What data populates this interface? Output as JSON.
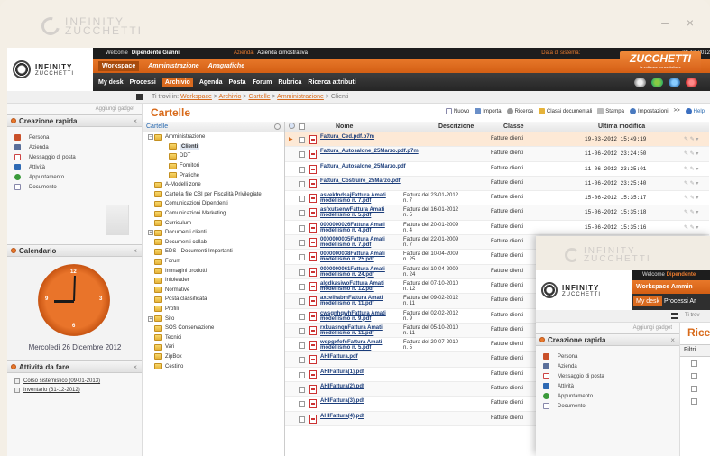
{
  "outer": {
    "logo_line1": "INFINITY",
    "logo_line2": "ZUCCHETTI",
    "controls": "– ×"
  },
  "header": {
    "logo_line1": "INFINITY",
    "logo_line2": "ZUCCHETTI",
    "welcome_label": "Welcome",
    "user": "Dipendente Gianni",
    "company_label": "Azienda:",
    "company": "Azienda dimostrativa",
    "date_label": "Data di sistema:",
    "date": "26-12-2012",
    "brand": "ZUCCHETTI",
    "brand_tagline": "la software house italiana",
    "modules": [
      "Workspace",
      "Amministrazione",
      "Anagrafiche"
    ],
    "menu": [
      "My desk",
      "Processi",
      "Archivio",
      "Agenda",
      "Posta",
      "Forum",
      "Rubrica",
      "Ricerca attributi"
    ]
  },
  "breadcrumb": {
    "prefix": "Ti trovi in:",
    "items": [
      "Workspace",
      "Archivio",
      "Cartelle",
      "Amministrazione"
    ],
    "current": "Clienti",
    "sep": ">"
  },
  "left": {
    "add_gadget": "Aggiungi gadget",
    "quick_title": "Creazione rapida",
    "quick_items": [
      "Persona",
      "Azienda",
      "Messaggio di posta",
      "Attività",
      "Appuntamento",
      "Documento"
    ],
    "calendar_title": "Calendario",
    "calendar_date": "Mercoledì 26 Dicembre 2012",
    "todo_title": "Attività da fare",
    "todo_items": [
      "Corso sistemistico (09-01-2013)",
      "Inventario (31-12-2012)"
    ],
    "close": "×"
  },
  "main": {
    "title": "Cartelle",
    "toolbar": [
      "Nuovo",
      "Importa",
      "Ricerca",
      "Classi documentali",
      "Stampa",
      "Impostazioni",
      ">>",
      "Help"
    ],
    "tree_root": "Cartelle",
    "tree": [
      {
        "label": "Amministrazione",
        "depth": 0,
        "pm": "−"
      },
      {
        "label": "Clienti",
        "depth": 2,
        "sel": true
      },
      {
        "label": "DDT",
        "depth": 2
      },
      {
        "label": "Fornitori",
        "depth": 2
      },
      {
        "label": "Pratiche",
        "depth": 2
      },
      {
        "label": "A-Modelli zone",
        "depth": 0
      },
      {
        "label": "Cartella file CBI per Fiscalità Privilegiate",
        "depth": 0
      },
      {
        "label": "Comunicazioni Dipendenti",
        "depth": 0
      },
      {
        "label": "Comunicazioni Marketing",
        "depth": 0
      },
      {
        "label": "Curriculum",
        "depth": 0
      },
      {
        "label": "Documenti clienti",
        "depth": 0,
        "pm": "+"
      },
      {
        "label": "Documenti collab",
        "depth": 0
      },
      {
        "label": "EDS - Documenti Importanti",
        "depth": 0
      },
      {
        "label": "Forum",
        "depth": 0
      },
      {
        "label": "Immagini prodotti",
        "depth": 0
      },
      {
        "label": "Infoleader",
        "depth": 0
      },
      {
        "label": "Normative",
        "depth": 0
      },
      {
        "label": "Posta classificata",
        "depth": 0
      },
      {
        "label": "Profili",
        "depth": 0
      },
      {
        "label": "Sito",
        "depth": 0,
        "pm": "+"
      },
      {
        "label": "SOS Conservazione",
        "depth": 0
      },
      {
        "label": "Tecnici",
        "depth": 0
      },
      {
        "label": "Vari",
        "depth": 0
      },
      {
        "label": "ZipBox",
        "depth": 0
      },
      {
        "label": "Cestino",
        "depth": 0
      }
    ],
    "grid_headers": [
      "Nome",
      "Descrizione",
      "Classe",
      "Ultima modifica"
    ],
    "rows": [
      {
        "name": "Fattura_Ced.pdf.p7m",
        "desc": "",
        "cls": "Fatture clienti",
        "date": "19-03-2012 15:49:19",
        "hl": true
      },
      {
        "name": "Fattura_Autosalone_25Marzo.pdf.p7m",
        "desc": "",
        "cls": "Fatture clienti",
        "date": "11-06-2012 23:24:50"
      },
      {
        "name": "Fattura_Autosalone_25Marzo.pdf",
        "desc": "",
        "cls": "Fatture clienti",
        "date": "11-06-2012 23:25:01"
      },
      {
        "name": "Fattura_Costruire_25Marzo.pdf",
        "desc": "",
        "cls": "Fatture clienti",
        "date": "11-06-2012 23:25:40"
      },
      {
        "name": "asvekfndsajFattura Amati modellismo n. 7.pdf",
        "desc": "Fattura del 23-01-2012 n. 7",
        "cls": "Fatture clienti",
        "date": "15-06-2012 15:35:17"
      },
      {
        "name": "asfxutsenwFattura Amati modellismo n. 5.pdf",
        "desc": "Fattura del 16-01-2012 n. 5",
        "cls": "Fatture clienti",
        "date": "15-06-2012 15:35:18"
      },
      {
        "name": "0000000026Fattura Amati modellismo n. 4.pdf",
        "desc": "Fattura del 20-01-2009 n. 4",
        "cls": "Fatture clienti",
        "date": "15-06-2012 15:35:16"
      },
      {
        "name": "0000000035Fattura Amati modellismo n. 7.pdf",
        "desc": "Fattura del 22-01-2009 n. 7",
        "cls": "Fatture clienti",
        "date": ""
      },
      {
        "name": "0000000038Fattura Amati modellismo n. 25.pdf",
        "desc": "Fattura del 10-04-2009 n. 25",
        "cls": "Fatture clienti",
        "date": ""
      },
      {
        "name": "0000000061Fattura Amati modellismo n. 24.pdf",
        "desc": "Fattura del 10-04-2009 n. 24",
        "cls": "Fatture clienti",
        "date": ""
      },
      {
        "name": "algdkasiwoFattura Amati modellismo n. 12.pdf",
        "desc": "Fattura del 07-10-2010 n. 12",
        "cls": "Fatture clienti",
        "date": ""
      },
      {
        "name": "axcelhabmFattura Amati modellismo n. 11.pdf",
        "desc": "Fattura del 09-02-2012 n. 11",
        "cls": "Fatture clienti",
        "date": ""
      },
      {
        "name": "cwsgnhqwhFattura Amati modellismo n. 9.pdf",
        "desc": "Fattura del 02-02-2012 n. 9",
        "cls": "Fatture clienti",
        "date": ""
      },
      {
        "name": "rxkuasnqnFattura Amati modellismo n. 11.pdf",
        "desc": "Fattura del 05-10-2010 n. 11",
        "cls": "Fatture clienti",
        "date": ""
      },
      {
        "name": "wdpgxfofcFattura Amati modellismo n. 5.pdf",
        "desc": "Fattura del 20-07-2010 n. 5",
        "cls": "Fatture clienti",
        "date": ""
      },
      {
        "name": "AHIFattura.pdf",
        "desc": "",
        "cls": "Fatture clienti",
        "date": ""
      },
      {
        "name": "AHIFattura(1).pdf",
        "desc": "",
        "cls": "Fatture clienti",
        "date": ""
      },
      {
        "name": "AHIFattura(2).pdf",
        "desc": "",
        "cls": "Fatture clienti",
        "date": ""
      },
      {
        "name": "AHIFattura(3).pdf",
        "desc": "",
        "cls": "Fatture clienti",
        "date": ""
      },
      {
        "name": "AHIFattura(4).pdf",
        "desc": "",
        "cls": "Fatture clienti",
        "date": ""
      }
    ]
  },
  "overlay": {
    "logo_line1": "INFINITY",
    "logo_line2": "ZUCCHETTI",
    "welcome": "Welcome",
    "user": "Dipendente",
    "modules": "Workspace   Ammin",
    "menu_active": "My desk",
    "menu_rest": "Processi  Ar",
    "bc": "Ti trov",
    "add_gadget": "Aggiungi gadget",
    "right_title": "Rice",
    "filter": "Filtri",
    "quick_title": "Creazione rapida",
    "quick_items": [
      "Persona",
      "Azienda",
      "Messaggio di posta",
      "Attività",
      "Appuntamento",
      "Documento"
    ]
  },
  "colors": {
    "accent": "#d86a1a",
    "header_dark": "#2b2b2b",
    "link": "#1a3c7a"
  }
}
